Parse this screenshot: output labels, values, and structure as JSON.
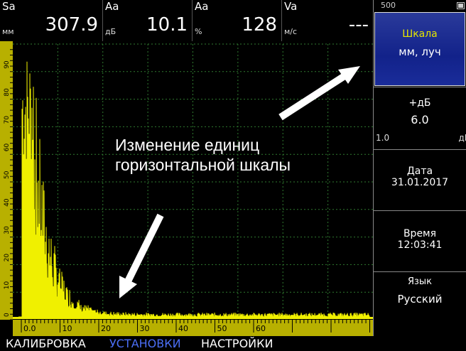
{
  "measurements": [
    {
      "name": "Sa",
      "unit": "мм",
      "value": "307.9"
    },
    {
      "name": "Aa",
      "unit": "дБ",
      "value": "10.1"
    },
    {
      "name": "Aa",
      "unit": "%",
      "value": "128"
    },
    {
      "name": "Va",
      "unit": "м/с",
      "value": "---"
    }
  ],
  "y_axis": {
    "ticks": [
      "0",
      "10",
      "20",
      "30",
      "40",
      "50",
      "60",
      "70",
      "80",
      "90"
    ]
  },
  "x_axis": {
    "ticks": [
      "0.0",
      "10",
      "20",
      "30",
      "40",
      "50",
      "60"
    ]
  },
  "annotation": {
    "line1": "Изменение единиц",
    "line2": "горизонтальной шкалы"
  },
  "panel": {
    "top_value": "500",
    "battery_icon": "battery-icon",
    "scale": {
      "label": "Шкала",
      "value": "мм, луч"
    },
    "gain": {
      "label": "+дБ",
      "value": "6.0",
      "step": "1.0",
      "unit": "дБ"
    },
    "date": {
      "label": "Дата",
      "value": "31.01.2017"
    },
    "time": {
      "label": "Время",
      "value": "12:03:41"
    },
    "language": {
      "label": "Язык",
      "value": "Русский"
    }
  },
  "tabs": [
    {
      "label": "КАЛИБРОВКА",
      "active": false
    },
    {
      "label": "УСТАНОВКИ",
      "active": true
    },
    {
      "label": "НАСТРОЙКИ",
      "active": false
    }
  ],
  "colors": {
    "signal": "#f0f000",
    "axis": "#b8b000",
    "grid": "#2f7a2f",
    "panel_active": "#1a2c9a",
    "tab_active": "#4b6ef5"
  }
}
